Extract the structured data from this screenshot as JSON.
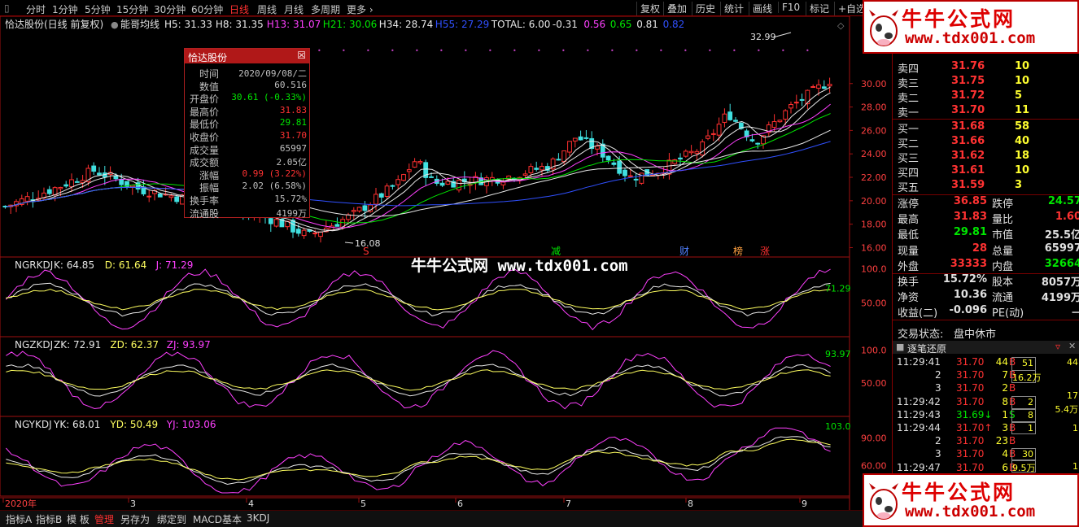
{
  "toolbar": {
    "periods": [
      "分时",
      "1分钟",
      "5分钟",
      "15分钟",
      "30分钟",
      "60分钟",
      "日线",
      "周线",
      "月线",
      "多周期",
      "更多 ›"
    ],
    "active": "日线",
    "right": [
      "复权",
      "叠加",
      "历史",
      "统计",
      "画线",
      "F10",
      "标记",
      "+自选"
    ]
  },
  "title": {
    "stock": "恰达股份(日线 前复权)",
    "indicator": "能哥均线",
    "ma": [
      {
        "t": "H5: 31.33",
        "c": "#e8e8e8"
      },
      {
        "t": "H8: 31.35",
        "c": "#e8e8e8"
      },
      {
        "t": "H13: 31.07",
        "c": "#ff40ff"
      },
      {
        "t": "H21: 30.06",
        "c": "#00e600"
      },
      {
        "t": "H34: 28.74",
        "c": "#e8e8e8"
      },
      {
        "t": "H55: 27.29",
        "c": "#3050ff"
      },
      {
        "t": "TOTAL: 6.00",
        "c": "#e8e8e8"
      },
      {
        "t": "-0.31",
        "c": "#e8e8e8"
      },
      {
        "t": "0.56",
        "c": "#ff40ff"
      },
      {
        "t": "0.65",
        "c": "#00e600"
      },
      {
        "t": "0.81",
        "c": "#e8e8e8"
      },
      {
        "t": "0.82",
        "c": "#3050ff"
      }
    ]
  },
  "price_axis": [
    "30.00",
    "28.00",
    "26.00",
    "24.00",
    "22.00",
    "20.00",
    "18.00",
    "16.00"
  ],
  "markers": {
    "high": "32.99",
    "low": "16.08",
    "labels": [
      {
        "t": "S",
        "c": "#ff3030"
      },
      {
        "t": "减",
        "c": "#00e600"
      },
      {
        "t": "财",
        "c": "#5080ff"
      },
      {
        "t": "榜",
        "c": "#ffa040"
      },
      {
        "t": "涨",
        "c": "#ff3030"
      }
    ]
  },
  "panels": [
    {
      "title": "NGRKDJ",
      "vals": [
        {
          "t": "K: 64.85",
          "c": "#e8e8e8"
        },
        {
          "t": "D: 61.64",
          "c": "#ffff60"
        },
        {
          "t": "J: 71.29",
          "c": "#ff40ff"
        }
      ],
      "axis": [
        "100.0",
        "50.00"
      ],
      "last": "71.29"
    },
    {
      "title": "NGZKDJ",
      "vals": [
        {
          "t": "ZK: 72.91",
          "c": "#e8e8e8"
        },
        {
          "t": "ZD: 62.37",
          "c": "#ffff60"
        },
        {
          "t": "ZJ: 93.97",
          "c": "#ff40ff"
        }
      ],
      "axis": [
        "100.0",
        "50.00"
      ],
      "last": "93.97"
    },
    {
      "title": "NGYKDJ",
      "vals": [
        {
          "t": "YK: 68.01",
          "c": "#e8e8e8"
        },
        {
          "t": "YD: 50.49",
          "c": "#ffff60"
        },
        {
          "t": "YJ: 103.06",
          "c": "#ff40ff"
        }
      ],
      "axis": [
        "90.00",
        "60.00"
      ],
      "last": "103.0"
    }
  ],
  "date_axis": [
    "2020年",
    "3",
    "4",
    "5",
    "6",
    "7",
    "8",
    "9"
  ],
  "info_popup": {
    "title": "恰达股份",
    "close": "☒",
    "rows": [
      {
        "label": "时间",
        "value": "2020/09/08/二",
        "color": "#c0c0c0"
      },
      {
        "label": "数值",
        "value": "60.516",
        "color": "#c0c0c0"
      },
      {
        "label": "开盘价",
        "value": "30.61 (-0.33%)",
        "color": "#00e600"
      },
      {
        "label": "最高价",
        "value": "31.83",
        "color": "#ff3232"
      },
      {
        "label": "最低价",
        "value": "29.81",
        "color": "#00e600"
      },
      {
        "label": "收盘价",
        "value": "31.70",
        "color": "#ff3232"
      },
      {
        "label": "成交量",
        "value": "65997",
        "color": "#c0c0c0"
      },
      {
        "label": "成交额",
        "value": "2.05亿",
        "color": "#c0c0c0"
      },
      {
        "label": "涨幅",
        "value": "0.99 (3.22%)",
        "color": "#ff3232"
      },
      {
        "label": "振幅",
        "value": "2.02 (6.58%)",
        "color": "#c0c0c0"
      },
      {
        "label": "换手率",
        "value": "15.72%",
        "color": "#c0c0c0"
      },
      {
        "label": "流通股",
        "value": "4199万",
        "color": "#c0c0c0"
      }
    ]
  },
  "watermark": {
    "center": "牛牛公式网 www.tdx001.com",
    "logo_title": "牛牛公式网",
    "logo_url": "www.tdx001.com"
  },
  "bottom_tabs": [
    "指标A",
    "指标B",
    "模 板",
    "管理",
    "另存为",
    "绑定到",
    "MACD基本",
    "3KDJ"
  ],
  "bottom_active": "管理",
  "orderbook": {
    "asks": [
      {
        "n": "卖四",
        "p": "31.76",
        "v": "10"
      },
      {
        "n": "卖三",
        "p": "31.75",
        "v": "10"
      },
      {
        "n": "卖二",
        "p": "31.72",
        "v": "5"
      },
      {
        "n": "卖一",
        "p": "31.70",
        "v": "11"
      }
    ],
    "bids": [
      {
        "n": "买一",
        "p": "31.68",
        "v": "58"
      },
      {
        "n": "买二",
        "p": "31.66",
        "v": "40"
      },
      {
        "n": "买三",
        "p": "31.62",
        "v": "18"
      },
      {
        "n": "买四",
        "p": "31.61",
        "v": "10"
      },
      {
        "n": "买五",
        "p": "31.59",
        "v": "3"
      }
    ]
  },
  "stats": [
    [
      {
        "l": "涨停",
        "v": "36.85",
        "c": "#ff3232"
      },
      {
        "l": "跌停",
        "v": "24.57",
        "c": "#00e600"
      }
    ],
    [
      {
        "l": "最高",
        "v": "31.83",
        "c": "#ff3232"
      },
      {
        "l": "量比",
        "v": "1.60",
        "c": "#ff3232"
      }
    ],
    [
      {
        "l": "最低",
        "v": "29.81",
        "c": "#00e600"
      },
      {
        "l": "市值",
        "v": "25.5亿",
        "c": "#e0e0e0"
      }
    ],
    [
      {
        "l": "现量",
        "v": "28",
        "c": "#ff3232"
      },
      {
        "l": "总量",
        "v": "65997",
        "c": "#e0e0e0"
      }
    ],
    [
      {
        "l": "外盘",
        "v": "33333",
        "c": "#ff3232"
      },
      {
        "l": "内盘",
        "v": "32664",
        "c": "#00e600"
      }
    ],
    [
      {
        "l": "换手",
        "v": "15.72%",
        "c": "#e0e0e0"
      },
      {
        "l": "股本",
        "v": "8057万",
        "c": "#e0e0e0"
      }
    ],
    [
      {
        "l": "净资",
        "v": "10.36",
        "c": "#e0e0e0"
      },
      {
        "l": "流通",
        "v": "4199万",
        "c": "#e0e0e0"
      }
    ],
    [
      {
        "l": "收益(二)",
        "v": "-0.096",
        "c": "#e0e0e0"
      },
      {
        "l": "PE(动)",
        "v": "－",
        "c": "#e0e0e0"
      }
    ]
  ],
  "trade_status": {
    "label": "交易状态:",
    "value": "盘中休市"
  },
  "ticks_header": "逐笔还原",
  "ticks": [
    {
      "time": "11:29:41",
      "price": "31.70",
      "vol": "44",
      "bs": "B",
      "pc": "#ff3232"
    },
    {
      "time": "2",
      "price": "31.70",
      "vol": "7",
      "bs": "B",
      "pc": "#ff3232"
    },
    {
      "time": "3",
      "price": "31.70",
      "vol": "2",
      "bs": "B",
      "pc": "#ff3232"
    },
    {
      "time": "11:29:42",
      "price": "31.70",
      "vol": "8",
      "bs": "B",
      "pc": "#ff3232"
    },
    {
      "time": "11:29:43",
      "price": "31.69↓",
      "vol": "1",
      "bs": "S",
      "pc": "#00e600"
    },
    {
      "time": "11:29:44",
      "price": "31.70↑",
      "vol": "3",
      "bs": "B",
      "pc": "#ff3232"
    },
    {
      "time": "2",
      "price": "31.70",
      "vol": "23",
      "bs": "B",
      "pc": "#ff3232"
    },
    {
      "time": "3",
      "price": "31.70",
      "vol": "4",
      "bs": "B",
      "pc": "#ff3232"
    },
    {
      "time": "11:29:47",
      "price": "31.70",
      "vol": "6",
      "bs": "B",
      "pc": "#ff3232"
    }
  ],
  "tick_boxes": [
    "51",
    "16.2万",
    "2",
    "8",
    "1",
    "30",
    "9.5万",
    "6"
  ],
  "tick_side": [
    "44",
    "17",
    "5.4万",
    "1",
    "1"
  ]
}
